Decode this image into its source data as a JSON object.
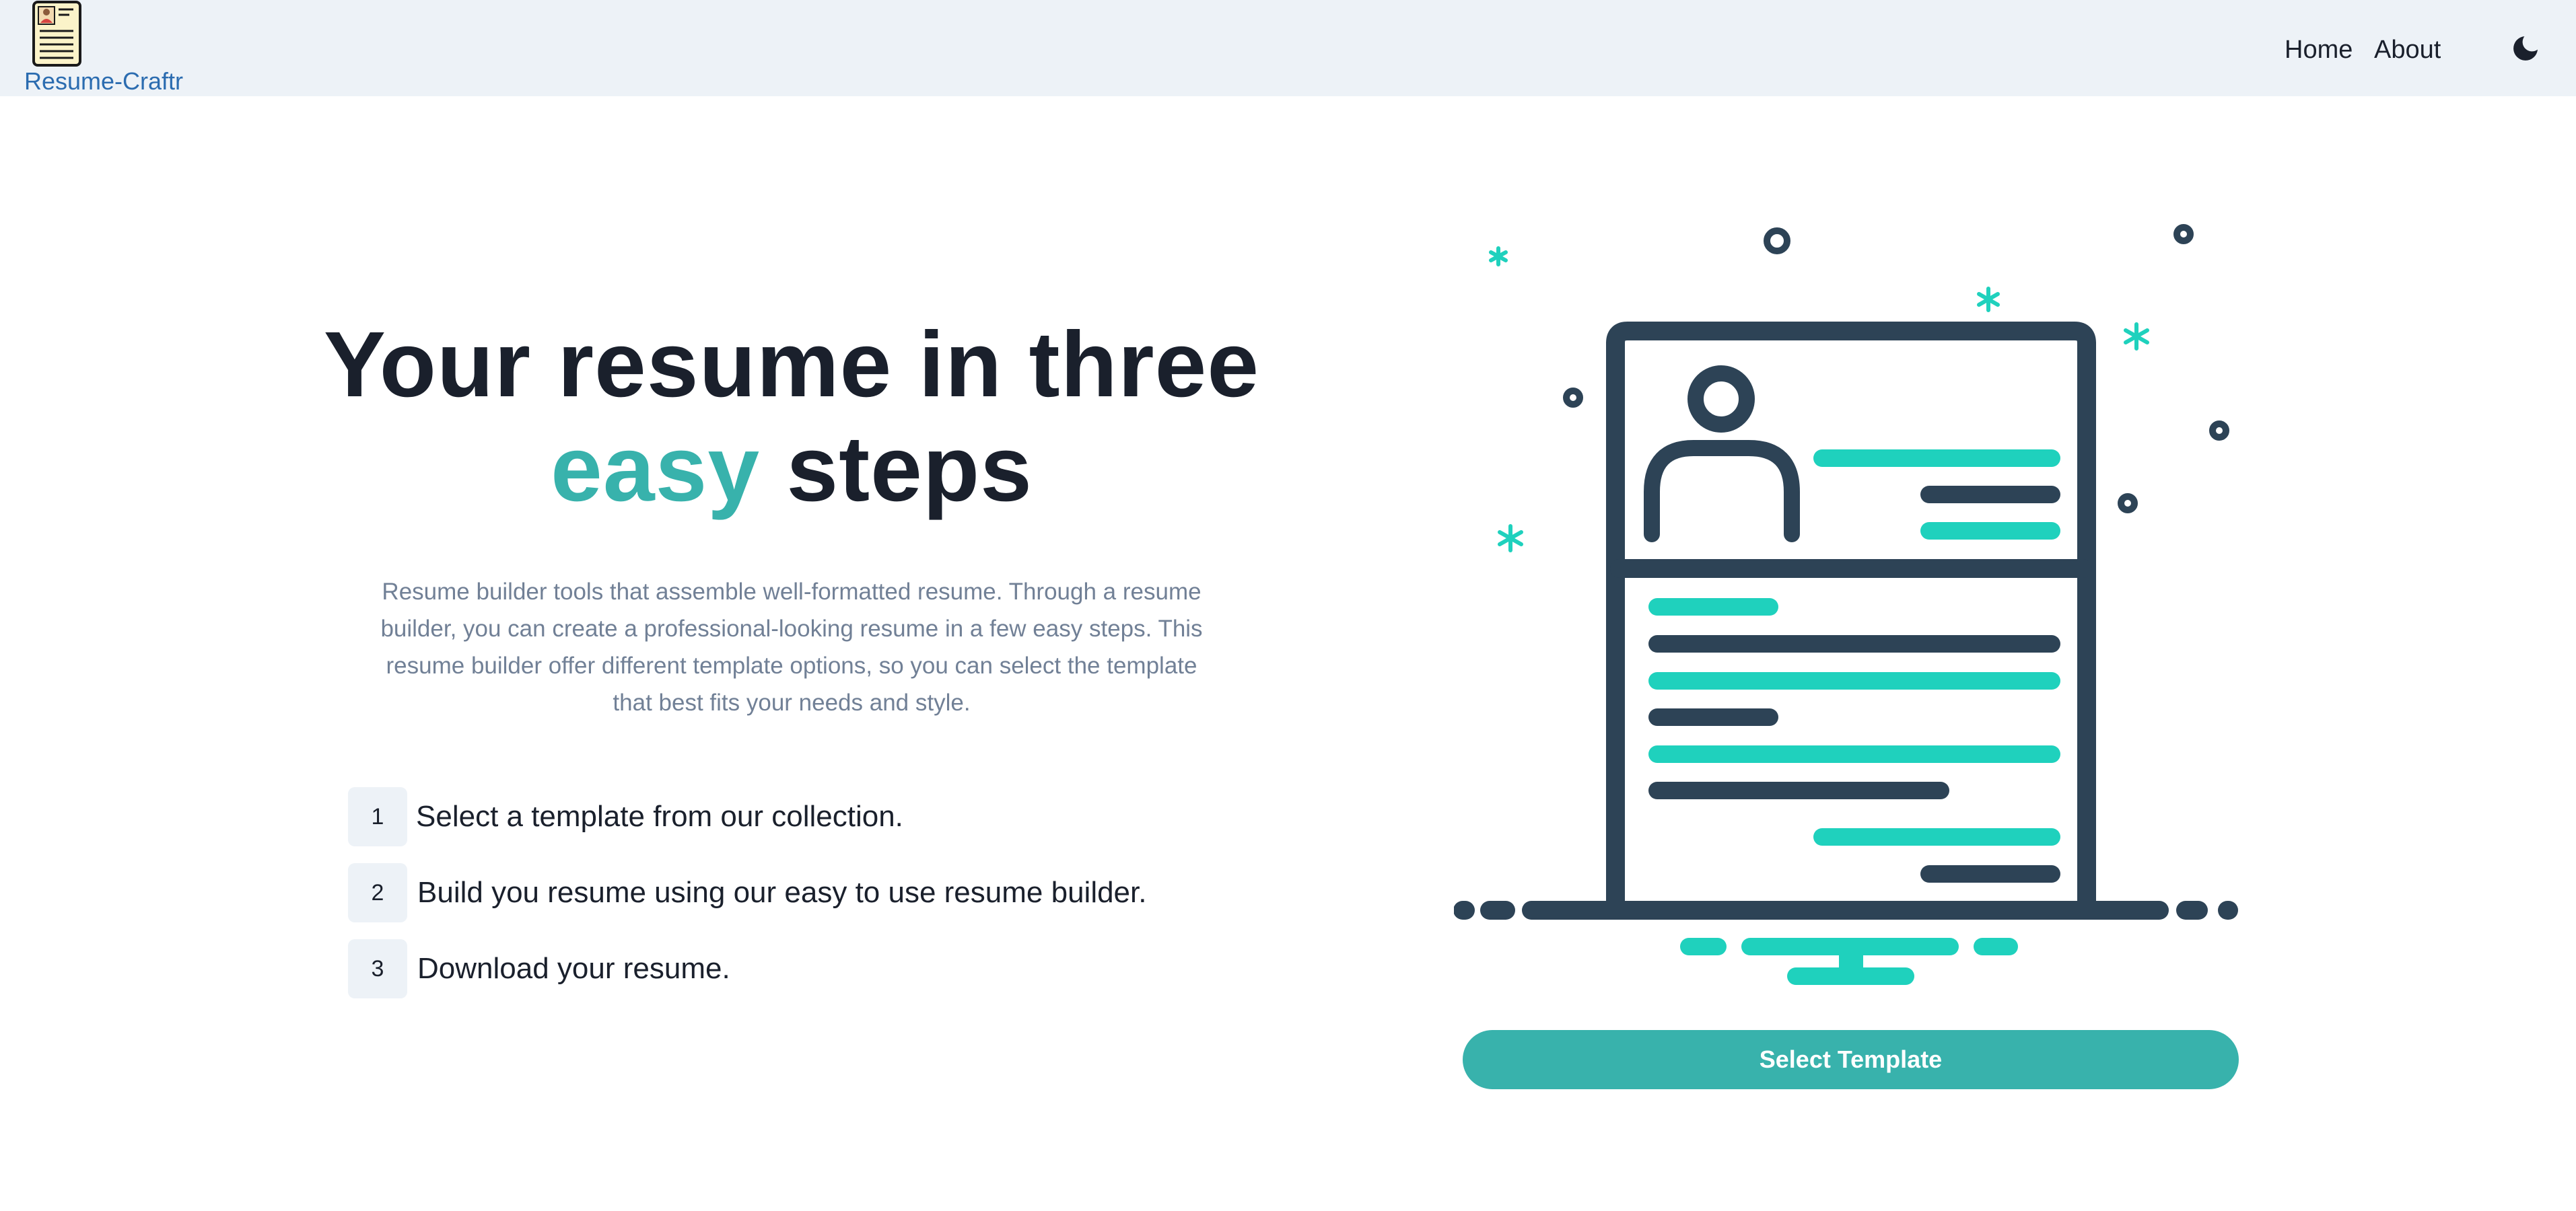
{
  "brand": {
    "name": "Resume-Craftr",
    "logo_icon": "resume-document-icon"
  },
  "nav": {
    "items": [
      {
        "label": "Home"
      },
      {
        "label": "About"
      }
    ],
    "theme_toggle_icon": "moon-icon"
  },
  "hero": {
    "title_line1": "Your resume in three",
    "title_accent": "easy",
    "title_rest": "steps",
    "description": "Resume builder tools that assemble well-formatted resume. Through a resume builder, you can create a professional-looking resume in a few easy steps. This resume builder offer different template options, so you can select the template that best fits your needs and style.",
    "steps": [
      {
        "number": "1",
        "text": "Select a template from our collection."
      },
      {
        "number": "2",
        "text": "Build you resume using our easy to use resume builder."
      },
      {
        "number": "3",
        "text": "Download your resume."
      }
    ],
    "cta_label": "Select Template",
    "illustration_icon": "resume-illustration-icon"
  },
  "colors": {
    "accent": "#38b2ac",
    "illustration_teal": "#1fd1bd",
    "illustration_dark": "#2d4356",
    "navbar_bg": "#edf2f7",
    "brand_link": "#2b6cb0"
  }
}
